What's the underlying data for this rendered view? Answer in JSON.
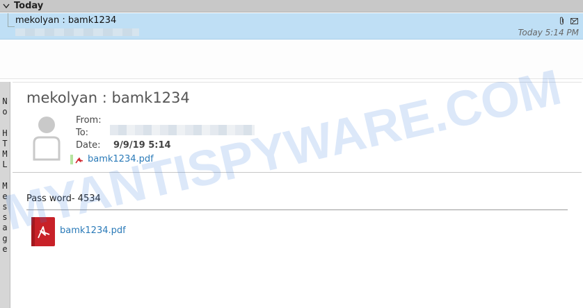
{
  "group": {
    "label": "Today"
  },
  "message_row": {
    "subject": "mekolyan : bamk1234",
    "date": "Today 5:14 PM"
  },
  "side_label": "No HTML Message",
  "preview": {
    "subject": "mekolyan : bamk1234",
    "from_label": "From:",
    "to_label": "To:",
    "date_label": "Date:",
    "date_value": "9/9/19 5:14",
    "attachment_name": "bamk1234.pdf"
  },
  "body": {
    "text": "Pass word- 4534",
    "attachment_name": "bamk1234.pdf"
  },
  "watermark": {
    "text": "MYANTISPYWARE.COM"
  },
  "icons": {
    "group_toggle": "chevron-down-icon",
    "attachment": "paperclip-icon",
    "forward": "forward-icon",
    "avatar": "contact-avatar-icon",
    "pdf_small": "pdf-icon",
    "pdf_large": "pdf-file-icon"
  },
  "colors": {
    "selected_row": "#bfdff5",
    "link": "#2a7ab8",
    "pdf_red": "#d1272f",
    "watermark": "#3d7fe0"
  }
}
